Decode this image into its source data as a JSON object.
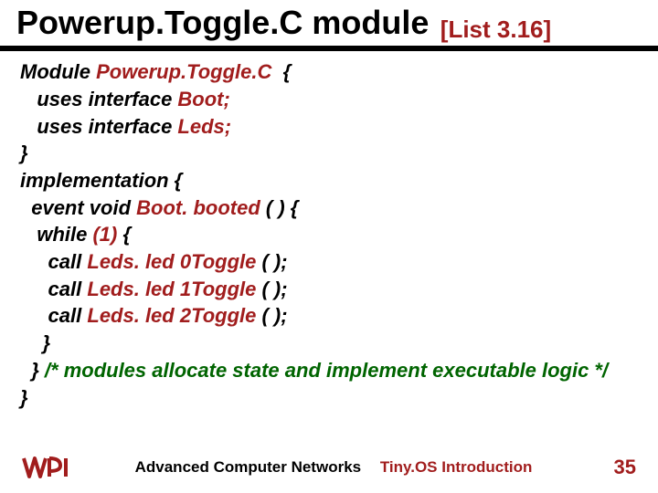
{
  "title": {
    "main": "Powerup.Toggle.C module",
    "listing": "[List 3.16]"
  },
  "code": {
    "l1a": "Module ",
    "l1b": "Powerup.Toggle.C ",
    "l1c": " {",
    "l2a": "   uses interface ",
    "l2b": "Boot;",
    "l3a": "   uses interface ",
    "l3b": "Leds;",
    "l4": "}",
    "l5": "implementation {",
    "l6a": "  event void ",
    "l6b": "Boot. booted",
    "l6c": " ( ) {",
    "l7a": "   while ",
    "l7b": "(1)",
    "l7c": " {",
    "l8a": "     call ",
    "l8b": "Leds. led 0Toggle",
    "l8c": " ( );",
    "l9a": "     call ",
    "l9b": "Leds. led 1Toggle",
    "l9c": " ( );",
    "l10a": "     call ",
    "l10b": "Leds. led 2Toggle",
    "l10c": " ( );",
    "l11": "    }",
    "l12a": "  } ",
    "l12b": "/* modules allocate state and implement executable logic */",
    "l13": "}"
  },
  "footer": {
    "text1": "Advanced Computer Networks",
    "text2": "Tiny.OS Introduction",
    "page": "35"
  }
}
